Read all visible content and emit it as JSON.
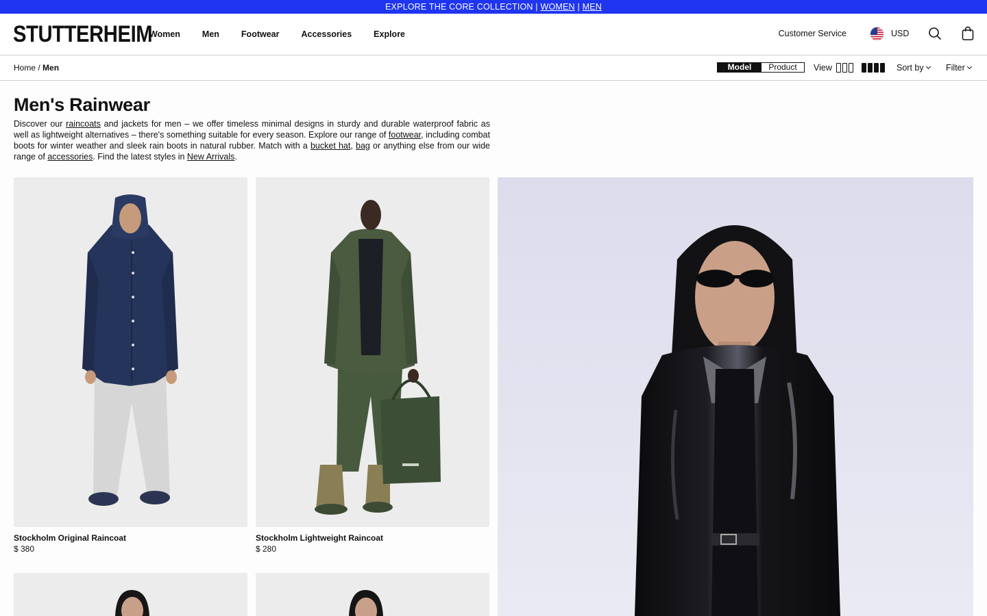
{
  "promo": {
    "text": "EXPLORE THE CORE COLLECTION |",
    "link_women": "WOMEN",
    "sep": "|",
    "link_men": "MEN"
  },
  "header": {
    "logo": "STUTTERHEIM",
    "nav": [
      "Women",
      "Men",
      "Footwear",
      "Accessories",
      "Explore"
    ],
    "customer_service": "Customer Service",
    "currency": "USD",
    "icons": [
      "us-flag-icon",
      "search-icon",
      "shopping-bag-icon"
    ]
  },
  "toolbar": {
    "breadcrumb_home": "Home",
    "breadcrumb_sep": "/",
    "breadcrumb_current": "Men",
    "view_mode_model": "Model",
    "view_mode_product": "Product",
    "view_label": "View",
    "sort_label": "Sort by",
    "filter_label": "Filter"
  },
  "intro": {
    "title": "Men's Rainwear",
    "p1": "Discover our ",
    "link_raincoats": "raincoats",
    "p2": " and jackets for men – we offer timeless minimal designs in sturdy and durable waterproof fabric as well as lightweight alternatives – there's something suitable for every season. Explore our range of ",
    "link_footwear": "footwear",
    "p3": ", including combat boots for winter weather and sleek rain boots in natural rubber. Match with a ",
    "link_bucket_hat": "bucket hat",
    "p4": ", ",
    "link_bag": "bag",
    "p5": " or anything else from our wide range of ",
    "link_accessories": "accessories",
    "p6": ". Find the latest styles in ",
    "link_new_arrivals": "New Arrivals",
    "p7": "."
  },
  "products": [
    {
      "name": "Stockholm Original Raincoat",
      "price": "$ 380",
      "coat_color": "#25345a"
    },
    {
      "name": "Stockholm Lightweight Raincoat",
      "price": "$ 280",
      "coat_color": "#4a5b40"
    }
  ],
  "colors": {
    "promo_bg": "#1f35f0",
    "image_bg": "#ececec",
    "feature_bg": "#dfe0f0"
  }
}
